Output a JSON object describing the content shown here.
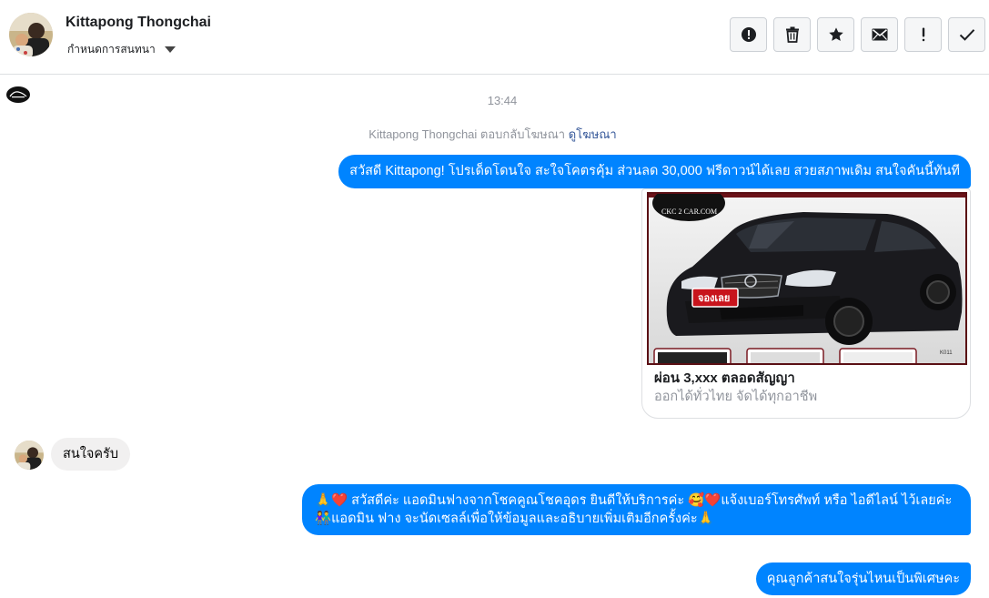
{
  "header": {
    "name": "Kittapong Thongchai",
    "subtitle": "กำหนดการสนทนา"
  },
  "chat": {
    "time": "13:44",
    "reply_note_text": "Kittapong Thongchai ตอบกลับโฆษณา",
    "reply_note_link": "ดูโฆษณา",
    "messages_out_1": "สวัสดี Kittapong! โปรเด็ดโดนใจ สะใจโคตรคุ้ม ส่วนลด 30,000 ฟรีดาวน์ได้เลย สวยสภาพเดิม สนใจคันนี้ทันที",
    "card": {
      "title": "ผ่อน 3,xxx ตลอดสัญญา",
      "subtitle": "ออกได้ทั่วไทย จัดได้ทุกอาชีพ",
      "brand": "CKC 2 CAR.COM",
      "badge": "จองเลย",
      "code": "K011"
    },
    "message_in": "สนใจครับ",
    "message_out_2_line1_a": "🙏❤️",
    "message_out_2_line1_b": " สวัสดีค่ะ แอดมินฟางจากโชคคูณโชคอุดร ยินดีให้บริการค่ะ ",
    "message_out_2_line1_c": "🥰❤️",
    "message_out_2_line1_d": "แจ้งเบอร์โทรศัพท์ หรือ ไอดีไลน์  ไว้เลยค่ะ",
    "message_out_2_line2_a": "👫",
    "message_out_2_line2_b": "แอดมิน ฟาง จะนัดเซลล์เพื่อให้ข้อมูลและอธิบายเพิ่มเติมอีกครั้งค่ะ",
    "message_out_2_line2_c": "🙏",
    "message_out_3": "คุณลูกค้าสนใจรุ่นไหนเป็นพิเศษคะ"
  },
  "colors": {
    "accent": "#0084ff",
    "incoming": "#f1f0f0",
    "muted": "#90949c",
    "link": "#365899"
  },
  "icons": [
    "alert-circle-icon",
    "trash-icon",
    "star-icon",
    "envelope-icon",
    "exclamation-icon",
    "check-icon"
  ]
}
